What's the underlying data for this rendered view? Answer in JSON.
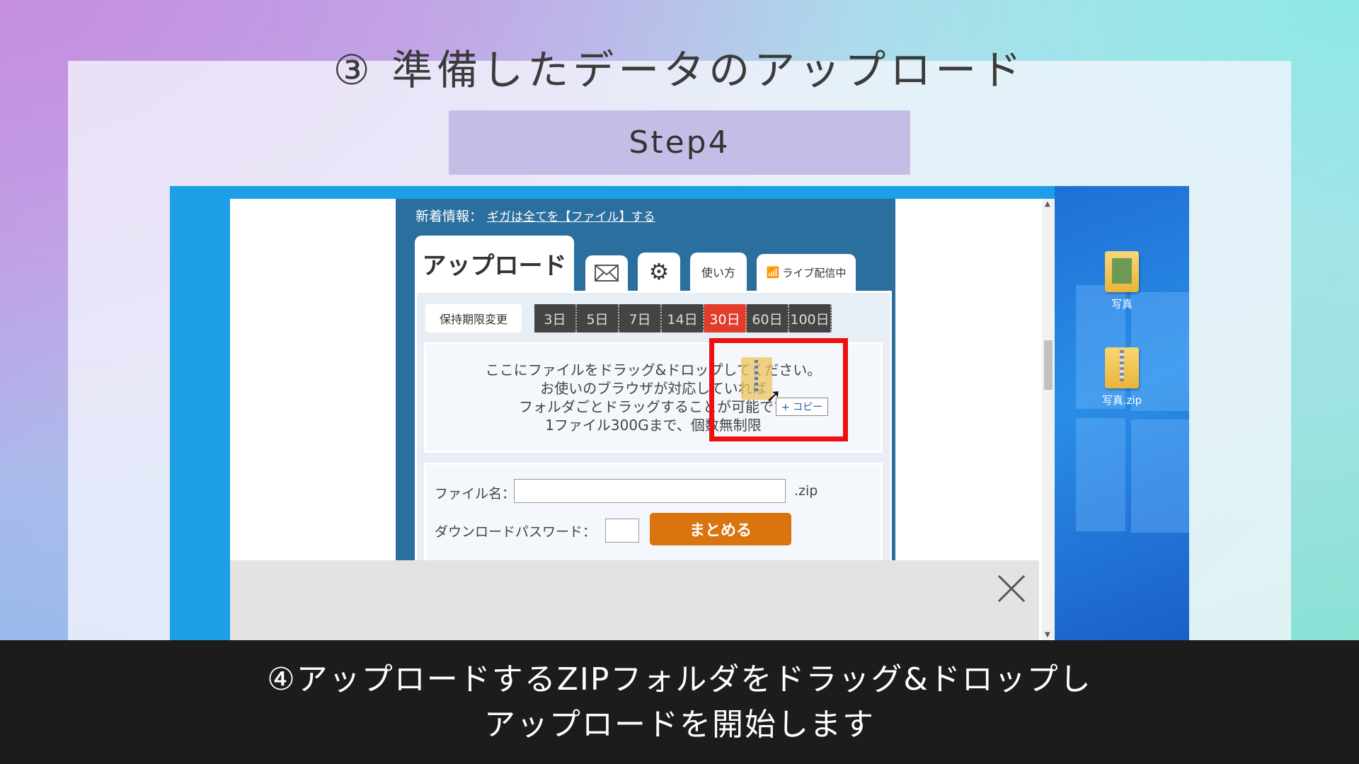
{
  "slide": {
    "title": "③ 準備したデータのアップロード",
    "step": "Step4"
  },
  "desktop": {
    "icons": [
      {
        "label": "写真",
        "icon": "photo-folder-icon"
      },
      {
        "label": "写真.zip",
        "icon": "zip-folder-icon"
      }
    ]
  },
  "site": {
    "news_label": "新着情報：",
    "news_link": "ギガは全てを【ファイル】する",
    "tabs": {
      "upload": "アップロード",
      "mail_icon": "mail-icon",
      "settings_icon": "gear-icon",
      "howto": "使い方",
      "live": "ライブ配信中"
    },
    "retention_button": "保持期限変更",
    "retention_days": [
      "3日",
      "5日",
      "7日",
      "14日",
      "30日",
      "60日",
      "100日"
    ],
    "retention_selected": "30日",
    "dropzone": [
      "ここにファイルをドラッグ&ドロップしてください。",
      "お使いのブラウザが対応していれば",
      "フォルダごとドラッグすることが可能です",
      "1ファイル300Gまで、個数無制限"
    ],
    "file_name_label": "ファイル名：",
    "file_name_value": "",
    "file_name_ext": ".zip",
    "download_password_label": "ダウンロードパスワード：",
    "download_password_value": "",
    "bundle_button": "まとめる"
  },
  "drag": {
    "tooltip": "+ コピー"
  },
  "caption": {
    "line1": "④アップロードするZIPフォルダをドラッグ&ドロップし",
    "line2": "アップロードを開始します"
  },
  "colors": {
    "accent_red": "#ee1010",
    "site_blue": "#2b6f9f",
    "selected_day": "#e23c2b",
    "bundle_button": "#d9740f",
    "step_badge": "#c5bde6"
  }
}
